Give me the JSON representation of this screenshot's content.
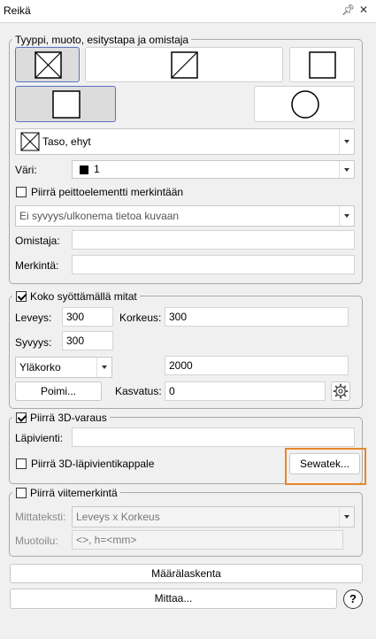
{
  "window": {
    "title": "Reikä",
    "pin_icon": "pin-icon",
    "close_icon": "close-icon"
  },
  "type_group": {
    "legend": "Tyyppi, muoto, esitystapa ja omistaja",
    "style_select": {
      "value": "Taso, ehyt"
    },
    "color": {
      "label": "Väri:",
      "value": "1",
      "swatch": "#000000"
    },
    "draw_cover": {
      "label": "Piirrä peittoelementti merkintään",
      "checked": false
    },
    "depth_select": {
      "value": "Ei syvyys/ulkonema tietoa kuvaan"
    },
    "owner": {
      "label": "Omistaja:",
      "value": ""
    },
    "marking": {
      "label": "Merkintä:",
      "value": ""
    }
  },
  "size_group": {
    "legend": "Koko syöttämällä mitat",
    "checked": true,
    "width": {
      "label": "Leveys:",
      "value": "300"
    },
    "height": {
      "label": "Korkeus:",
      "value": "300"
    },
    "depth": {
      "label": "Syvyys:",
      "value": "300"
    },
    "level_select": {
      "value": "Yläkorko"
    },
    "level_value": "2000",
    "pick_button": "Poimi...",
    "increment": {
      "label": "Kasvatus:",
      "value": "0"
    }
  },
  "reservation_group": {
    "legend": "Piirrä 3D-varaus",
    "checked": true,
    "penetration": {
      "label": "Läpivienti:",
      "value": ""
    },
    "draw_piece": {
      "label": "Piirrä 3D-läpivientikappale",
      "checked": false
    },
    "sewatek_button": "Sewatek...",
    "highlight_color": "#e8862a"
  },
  "dimension_group": {
    "legend": "Piirrä viitemerkintä",
    "checked": false,
    "dim_text": {
      "label": "Mittateksti:",
      "value": "Leveys x Korkeus"
    },
    "format": {
      "label": "Muotoilu:",
      "value": "<>, h=<mm>"
    }
  },
  "buttons": {
    "quantity": "Määrälaskenta",
    "measure": "Mittaa...",
    "help_icon": "help-icon"
  }
}
